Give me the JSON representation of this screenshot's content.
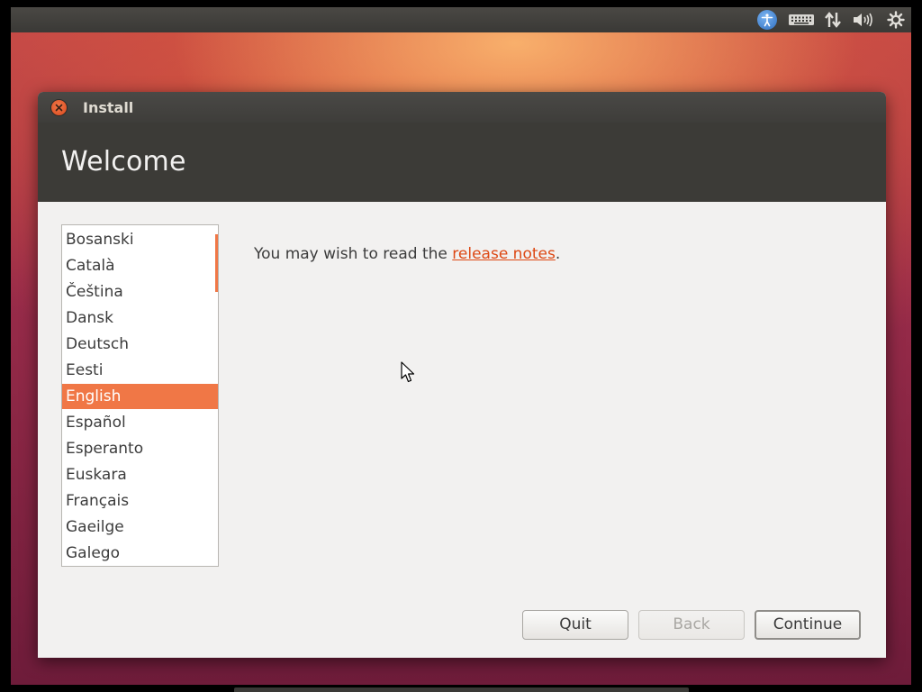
{
  "top_panel": {
    "icons": {
      "accessibility": "accessibility-icon",
      "keyboard": "keyboard-icon",
      "network": "network-icon",
      "volume": "volume-icon",
      "settings": "settings-icon"
    }
  },
  "window": {
    "title": "Install",
    "page_title": "Welcome",
    "languages": [
      "Bosanski",
      "Català",
      "Čeština",
      "Dansk",
      "Deutsch",
      "Eesti",
      "English",
      "Español",
      "Esperanto",
      "Euskara",
      "Français",
      "Gaeilge",
      "Galego"
    ],
    "selected_language": "English",
    "message_prefix": "You may wish to read the ",
    "message_link": "release notes",
    "message_suffix": ".",
    "buttons": {
      "quit": "Quit",
      "back": "Back",
      "continue": "Continue"
    }
  },
  "colors": {
    "accent": "#f07746",
    "link": "#dd4814",
    "header": "#3c3b37",
    "window_bg": "#f2f1f0"
  }
}
